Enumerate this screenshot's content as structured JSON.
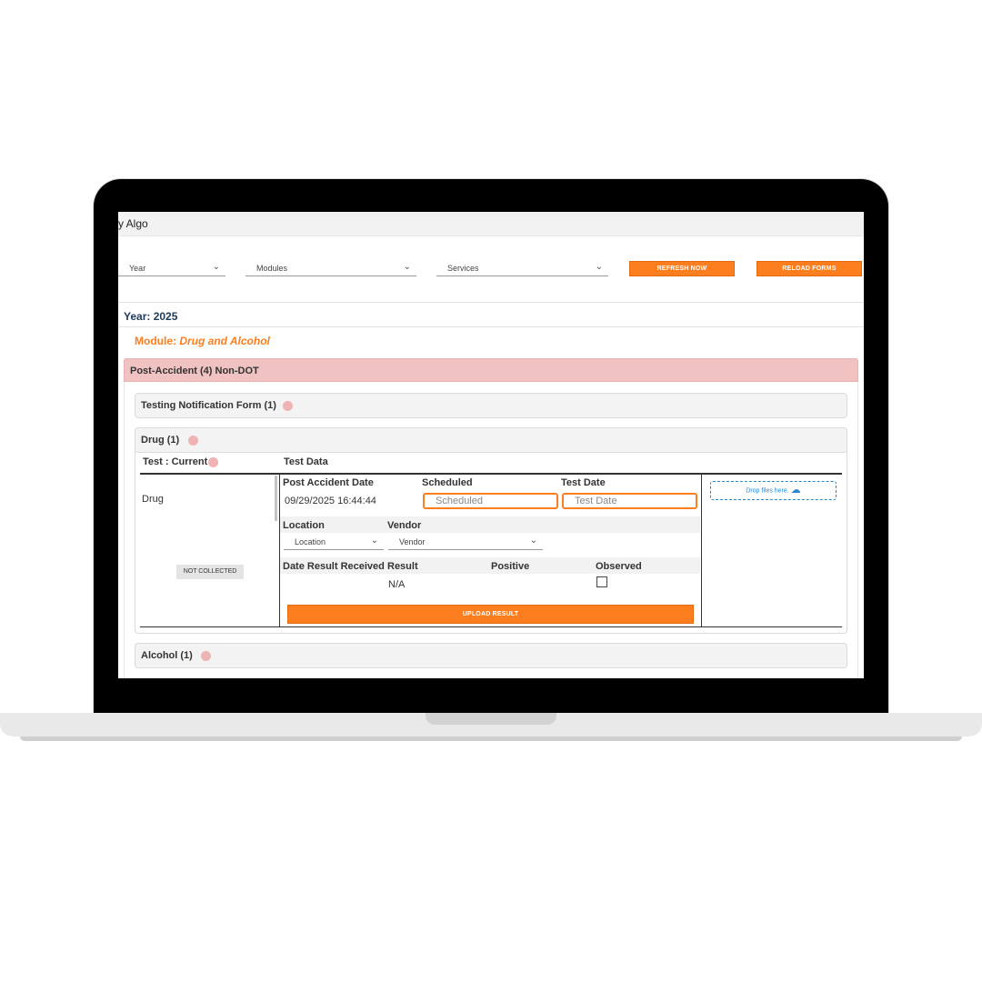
{
  "app": {
    "title": "y Algo"
  },
  "filters": {
    "year": "Year",
    "modules": "Modules",
    "services": "Services",
    "refresh_label": "REFRESH NOW",
    "reload_label": "RELOAD FORMS"
  },
  "year_heading": "Year: 2025",
  "module_heading": {
    "prefix": "Module: ",
    "name": "Drug and Alcohol"
  },
  "section": {
    "title": "Post-Accident (4) Non-DOT",
    "testing_notification": "Testing Notification Form (1)",
    "drug": {
      "title": "Drug (1)",
      "test_current": "Test : Current",
      "test_data": "Test Data",
      "test_name": "Drug",
      "status_badge": "NOT COLLECTED",
      "post_accident_date_label": "Post Accident Date",
      "post_accident_date_value": "09/29/2025 16:44:44",
      "scheduled_label": "Scheduled",
      "scheduled_placeholder": "Scheduled",
      "test_date_label": "Test Date",
      "test_date_placeholder": "Test Date",
      "location_label": "Location",
      "location_select": "Location",
      "vendor_label": "Vendor",
      "vendor_select": "Vendor",
      "date_result_received_label": "Date Result Received",
      "result_label": "Result",
      "result_value": "N/A",
      "positive_label": "Positive",
      "observed_label": "Observed",
      "upload_label": "UPLOAD RESULT",
      "drop_files": "Drop files here."
    },
    "alcohol": "Alcohol (1)"
  },
  "colors": {
    "accent": "#fd7e1f",
    "header_pink": "#f1c2c2",
    "dot": "#f0b3b3",
    "drop_blue": "#2a86c9"
  }
}
